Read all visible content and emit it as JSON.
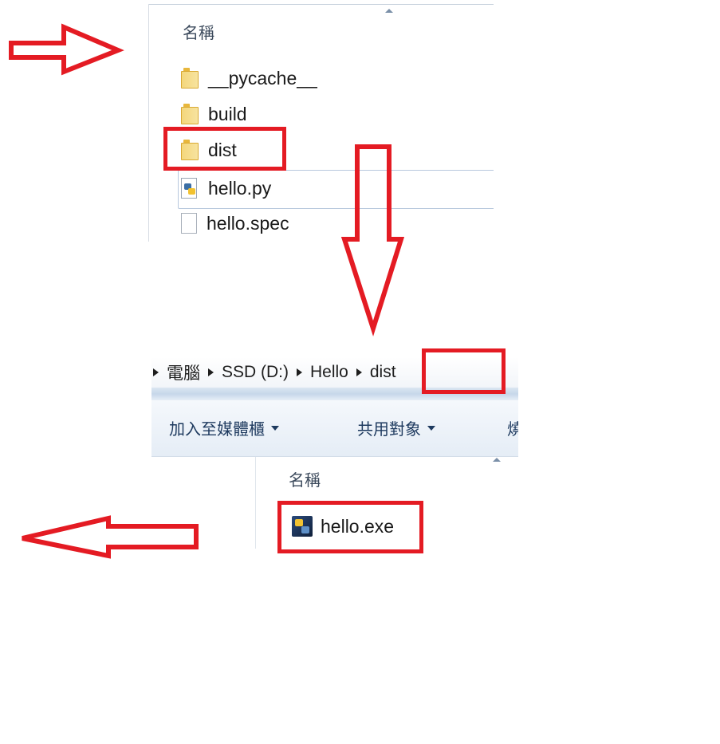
{
  "top_explorer": {
    "column_header": "名稱",
    "items": [
      {
        "name": "__pycache__",
        "icon": "folder-icon"
      },
      {
        "name": "build",
        "icon": "folder-icon"
      },
      {
        "name": "dist",
        "icon": "folder-icon"
      },
      {
        "name": "hello.py",
        "icon": "python-file-icon"
      },
      {
        "name": "hello.spec",
        "icon": "document-icon"
      }
    ]
  },
  "bottom_explorer": {
    "breadcrumb": [
      "電腦",
      "SSD (D:)",
      "Hello",
      "dist"
    ],
    "toolbar": {
      "add_to_library": "加入至媒體櫃",
      "share_with": "共用對象",
      "burn_partial": "燒"
    },
    "column_header": "名稱",
    "items": [
      {
        "name": "hello.exe",
        "icon": "executable-icon"
      }
    ]
  },
  "annotations": {
    "color": "#e41b23"
  }
}
